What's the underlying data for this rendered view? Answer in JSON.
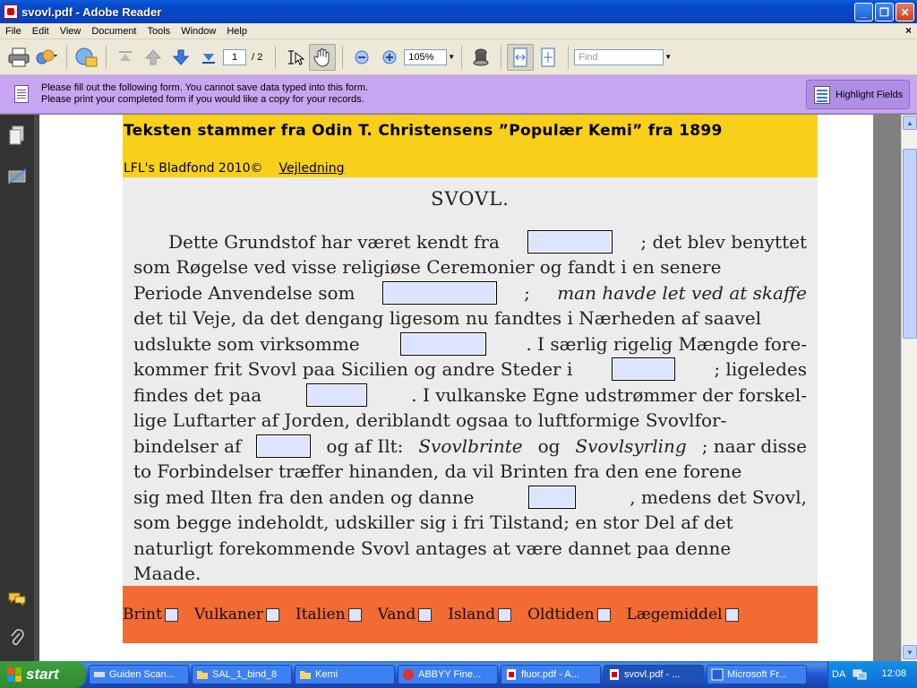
{
  "window": {
    "title": "svovl.pdf - Adobe Reader"
  },
  "menu": [
    "File",
    "Edit",
    "View",
    "Document",
    "Tools",
    "Window",
    "Help"
  ],
  "toolbar": {
    "page_current": "1",
    "page_total": "/ 2",
    "zoom": "105%",
    "find_placeholder": "Find"
  },
  "formbar": {
    "message_line1": "Please fill out the following form. You cannot save data typed into this form.",
    "message_line2": "Please print your completed form if you would like a copy for your records.",
    "highlight_label": "Highlight Fields"
  },
  "document": {
    "headline": "Teksten stammer fra Odin T. Christensens ”Populær Kemi” fra 1899",
    "copyright": "LFL's Bladfond 2010©",
    "guide_link": "Vejledning",
    "heading": "SVOVL.",
    "lines": {
      "l1a": "Dette Grundstof har været kendt fra",
      "l1b": "; det blev benyttet",
      "l2": "som Røgelse ved visse religiøse Ceremonier og fandt i en senere",
      "l3a": "Periode Anvendelse som",
      "l3b": ";",
      "l3c": "man havde let ved at skaffe",
      "l4": "det til Veje, da det dengang ligesom nu fandtes i Nærheden af saavel",
      "l5a": "udslukte som virksomme",
      "l5b": ". I særlig rigelig Mængde fore-",
      "l6a": "kommer frit Svovl paa Sicilien og andre Steder i",
      "l6b": "; ligeledes",
      "l7a": "findes det paa",
      "l7b": ". I vulkanske Egne udstrømmer der forskel-",
      "l8": "lige Luftarter af Jorden, deriblandt ogsaa to luftformige Svovlfor-",
      "l9a": "bindelser af",
      "l9b": "og af Ilt:",
      "l9c": "Svovlbrinte",
      "l9d": "og",
      "l9e": "Svovlsyrling",
      "l9f": "; naar disse",
      "l10": "to Forbindelser træffer hinanden, da vil Brinten fra den ene forene",
      "l11a": "sig med Ilten fra den anden og danne",
      "l11b": ", medens det Svovl,",
      "l12": "som begge indeholdt, udskiller sig i fri Tilstand; en stor Del af det",
      "l13": "naturligt forekommende Svovl antages at være dannet paa denne",
      "l14": "Maade."
    },
    "options": [
      "Brint",
      "Vulkaner",
      "Italien",
      "Vand",
      "Island",
      "Oldtiden",
      "Lægemiddel"
    ]
  },
  "taskbar": {
    "start": "start",
    "tasks": [
      "Guiden Scan...",
      "SAL_1_bind_8",
      "Kemi",
      "ABBYY Fine...",
      "fluor.pdf - A...",
      "svovl.pdf - ...",
      "Microsoft Fr..."
    ],
    "tray_text": "DA",
    "clock": "12:08"
  }
}
